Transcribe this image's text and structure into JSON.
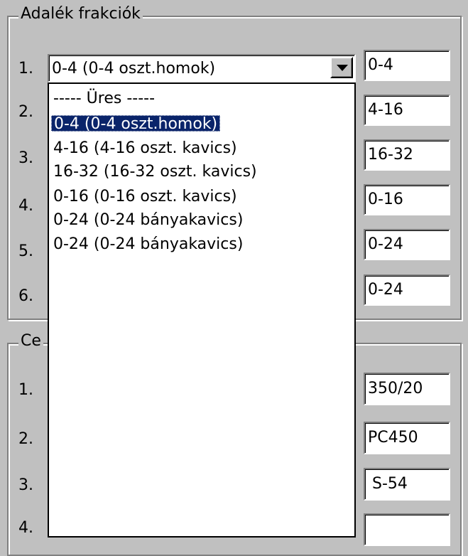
{
  "group1": {
    "title": "Adalék frakciók",
    "rows": [
      {
        "num": "1.",
        "value": "0-4"
      },
      {
        "num": "2.",
        "value": "4-16"
      },
      {
        "num": "3.",
        "value": "16-32"
      },
      {
        "num": "4.",
        "value": "0-16"
      },
      {
        "num": "5.",
        "value": "0-24"
      },
      {
        "num": "6.",
        "value": "0-24"
      }
    ]
  },
  "combo1": {
    "value": "0-4 (0-4 oszt.homok)",
    "options": [
      "----- Üres -----",
      "0-4 (0-4 oszt.homok)",
      "4-16 (4-16 oszt. kavics)",
      "16-32 (16-32 oszt. kavics)",
      "0-16 (0-16 oszt. kavics)",
      "0-24 (0-24 bányakavics)",
      "0-24 (0-24 bányakavics)"
    ],
    "selected_index": 1
  },
  "group2": {
    "title_visible": "Ce",
    "rows": [
      {
        "num": "1.",
        "value": "350/20"
      },
      {
        "num": "2.",
        "value": "PC450"
      },
      {
        "num": "3.",
        "value": "S-54"
      },
      {
        "num": "4.",
        "value": ""
      }
    ]
  },
  "colors": {
    "face": "#c0c0c0",
    "highlight": "#0a246a",
    "shadow": "#808080"
  }
}
